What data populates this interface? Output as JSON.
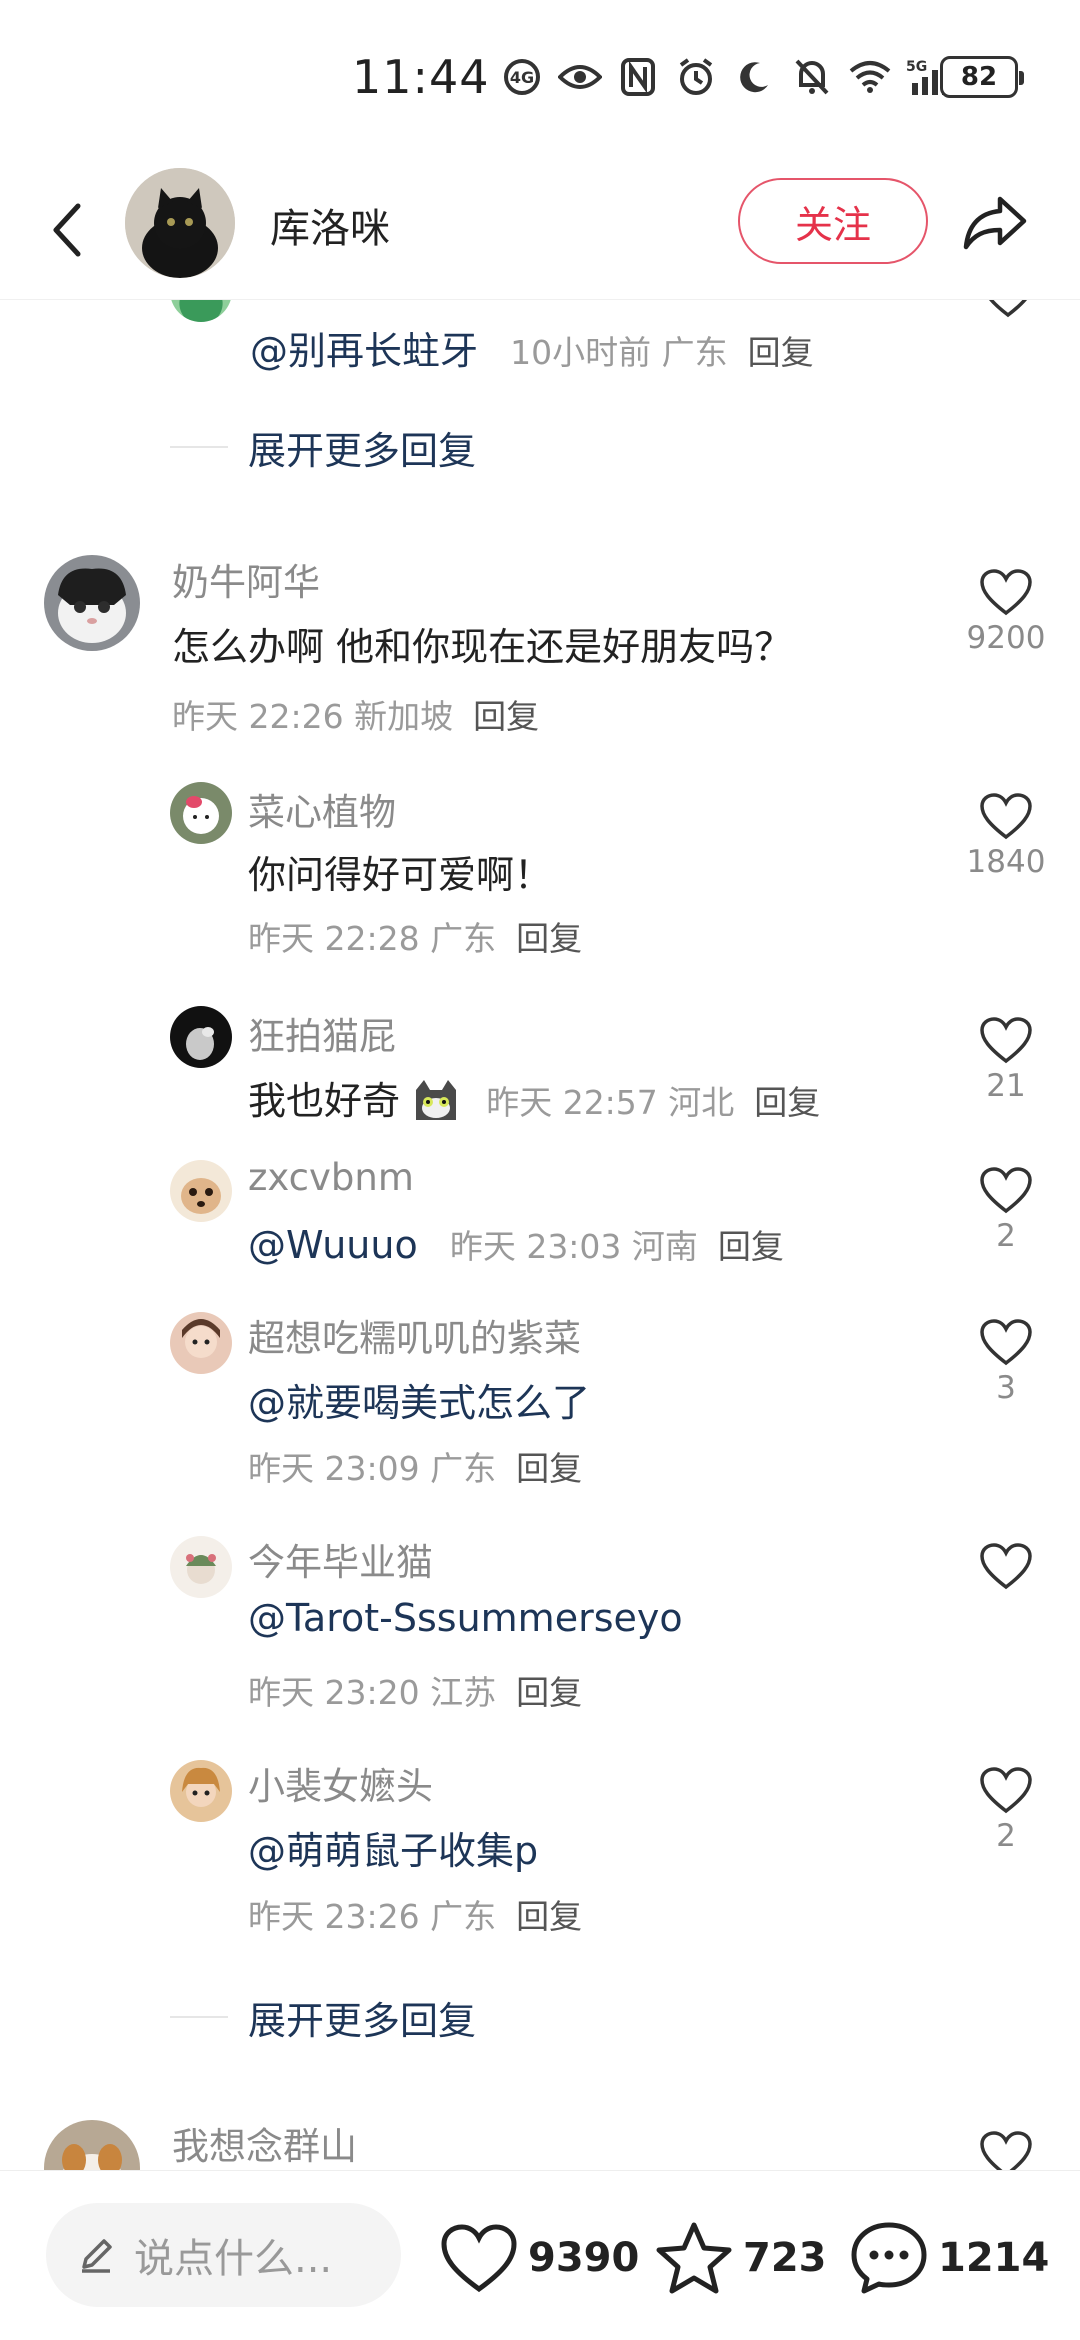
{
  "status_bar": {
    "time": "11:44",
    "battery": "82",
    "network": "5G",
    "icons": [
      "hd-icon",
      "eye-icon",
      "nfc-icon",
      "alarm-icon",
      "moon-icon",
      "mute-icon",
      "wifi-icon",
      "signal-icon"
    ]
  },
  "header": {
    "author_name": "库洛咪",
    "follow_label": "关注"
  },
  "thread_prev": {
    "comment_text": "@别再长蛀牙",
    "meta_time": "10小时前 广东",
    "reply_label": "回复",
    "expand_label": "展开更多回复"
  },
  "comments": [
    {
      "username": "奶牛阿华",
      "text": "怎么办啊 他和你现在还是好朋友吗？",
      "meta": "昨天 22:26 新加坡",
      "reply_label": "回复",
      "likes": "9200"
    }
  ],
  "replies": [
    {
      "username": "菜心植物",
      "text": "你问得好可爱啊！",
      "meta": "昨天 22:28 广东",
      "reply_label": "回复",
      "likes": "1840"
    },
    {
      "username": "狂拍猫屁",
      "text": "我也好奇",
      "meta": "昨天 22:57 河北",
      "reply_label": "回复",
      "likes": "21"
    },
    {
      "username": "zxcvbnm",
      "text": "@Wuuuo",
      "meta": "昨天 23:03 河南",
      "reply_label": "回复",
      "likes": "2"
    },
    {
      "username": "超想吃糯叽叽的紫菜",
      "text": "@就要喝美式怎么了",
      "meta": "昨天 23:09 广东",
      "reply_label": "回复",
      "likes": "3"
    },
    {
      "username": "今年毕业猫",
      "text": "@Tarot-Sssummerseyo",
      "meta": "昨天 23:20 江苏",
      "reply_label": "回复",
      "likes": ""
    },
    {
      "username": "小裴女嬷头",
      "text": "@萌萌鼠子收集p",
      "meta": "昨天 23:26 广东",
      "reply_label": "回复",
      "likes": "2"
    }
  ],
  "expand_more": "展开更多回复",
  "next_comment": {
    "username": "我想念群山"
  },
  "bottom_bar": {
    "input_placeholder": "说点什么...",
    "likes": "9390",
    "favorites": "723",
    "comments": "1214"
  },
  "colors": {
    "accent": "#e5324a",
    "mention": "#1d3557"
  }
}
